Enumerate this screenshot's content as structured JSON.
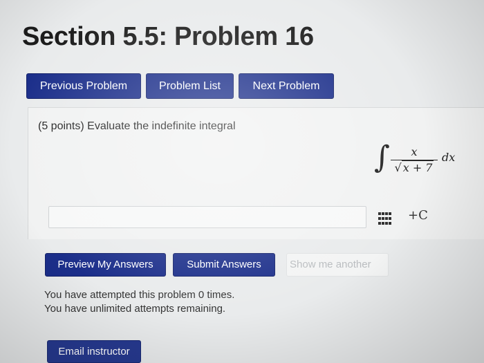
{
  "page": {
    "title": "Section 5.5: Problem 16"
  },
  "nav": {
    "previous_label": "Previous Problem",
    "list_label": "Problem List",
    "next_label": "Next Problem"
  },
  "problem": {
    "prompt": "(5 points) Evaluate the indefinite integral",
    "integral": {
      "sign": "∫",
      "numerator": "x",
      "radical": "√",
      "denominator_radicand": "x + 7",
      "differential": "dx"
    },
    "answer": {
      "value": "",
      "placeholder": ""
    },
    "tools_icon": "equation-editor-grid-icon",
    "constant": "+C"
  },
  "actions": {
    "preview_label": "Preview My Answers",
    "submit_label": "Submit Answers",
    "show_another_label": "Show me another"
  },
  "status": {
    "attempted": "You have attempted this problem 0 times.",
    "remaining": "You have unlimited attempts remaining."
  },
  "footer": {
    "email_label": "Email instructor"
  },
  "colors": {
    "button_primary": "#1b2e8a",
    "button_disabled_text": "#b9bcbf",
    "background": "#e9ebec"
  }
}
